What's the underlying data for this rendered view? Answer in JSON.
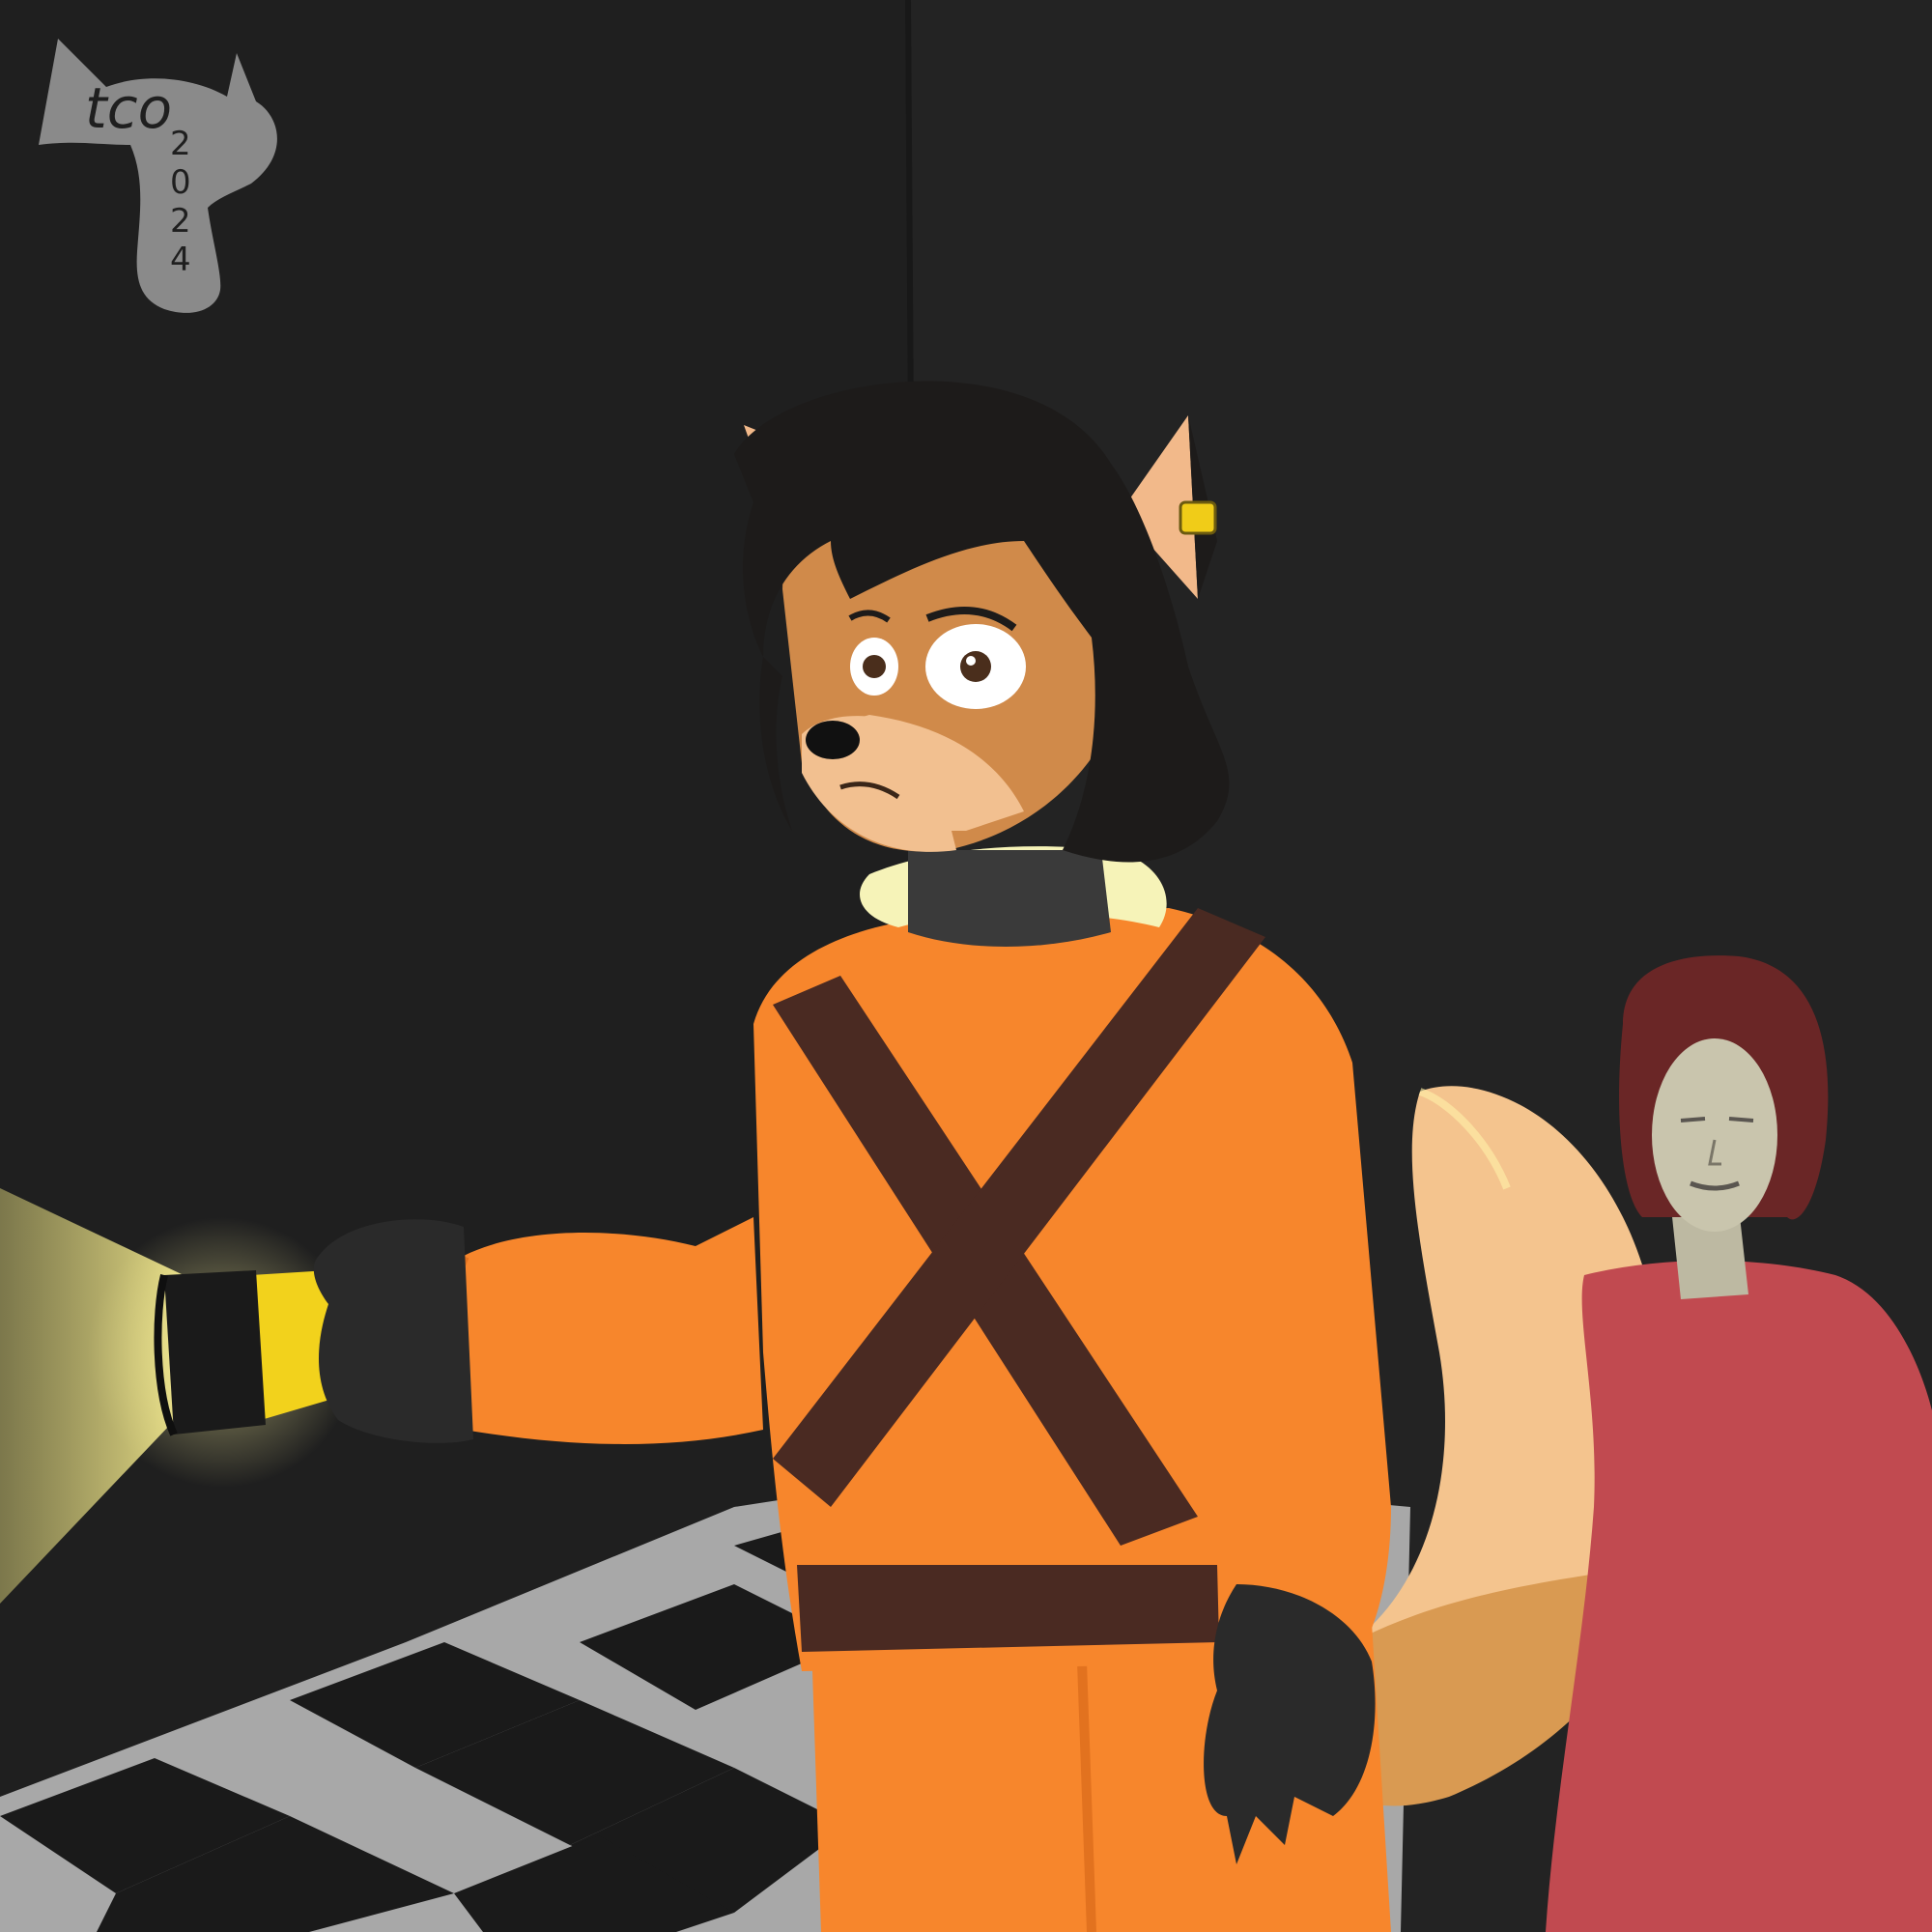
{
  "signature": {
    "initials": "tco",
    "year_digits": [
      "2",
      "0",
      "2",
      "4"
    ]
  },
  "colors": {
    "wall_left": "#1f1f1f",
    "wall_right": "#232323",
    "floor_light": "#a9a9a9",
    "floor_dark": "#1a1a1a",
    "jumpsuit": "#f7862c",
    "jumpsuit_shade": "#e2721f",
    "straps": "#4a2a22",
    "fur": "#d08a4a",
    "muzzle": "#f2c090",
    "hair": "#1d1b1a",
    "gloves": "#2a2a2a",
    "flashlight": "#f2d21c",
    "beam": "#f0e68a",
    "tail_cream": "#f4c48e",
    "tail_base": "#d99a52",
    "dress": "#c14a50",
    "doll_skin": "#c9c5ad",
    "doll_hair": "#6a2626",
    "signature_gray": "#8a8a8a",
    "earring": "#f0cc18"
  }
}
